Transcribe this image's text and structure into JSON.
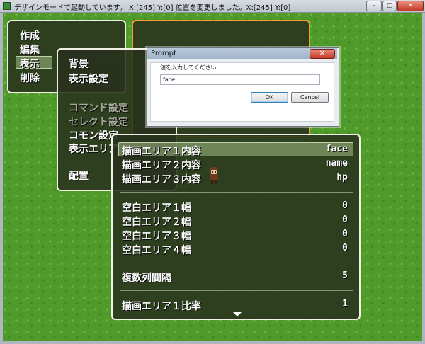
{
  "window": {
    "title": "デザインモードで起動しています。 X:[245] Y:[0] 位置を変更しました。X:[245] Y:[0]",
    "minimize_label": "–",
    "maximize_label": "□",
    "close_label": "✕"
  },
  "main_menu": {
    "items": [
      "作成",
      "編集",
      "表示",
      "削除"
    ],
    "selected_index": 2
  },
  "view_menu": {
    "items": [
      {
        "label": "背景",
        "enabled": true
      },
      {
        "label": "表示設定",
        "enabled": true
      },
      {
        "label": "コマンド設定",
        "enabled": false
      },
      {
        "label": "セレクト設定",
        "enabled": false
      },
      {
        "label": "コモン設定",
        "enabled": true
      },
      {
        "label": "表示エリア",
        "enabled": true
      },
      {
        "label": "配置",
        "enabled": true
      }
    ]
  },
  "settings_list": {
    "rows": [
      {
        "label": "描画エリア１内容",
        "value": "face"
      },
      {
        "label": "描画エリア２内容",
        "value": "name"
      },
      {
        "label": "描画エリア３内容",
        "value": "hp"
      },
      {
        "label": "空白エリア１幅",
        "value": "0"
      },
      {
        "label": "空白エリア２幅",
        "value": "0"
      },
      {
        "label": "空白エリア３幅",
        "value": "0"
      },
      {
        "label": "空白エリア４幅",
        "value": "0"
      },
      {
        "label": "複数列間隔",
        "value": "5"
      },
      {
        "label": "描画エリア１比率",
        "value": "1"
      }
    ],
    "selected_index": 0
  },
  "prompt": {
    "title": "Prompt",
    "close_label": "✕",
    "message": "値を入力してください",
    "input_value": "face",
    "ok_label": "OK",
    "cancel_label": "Cancel"
  },
  "colors": {
    "grass": "#4f9a2b",
    "window_bg": "#28301c",
    "window_border": "#f1f1e6",
    "highlight_border": "#f4a032"
  }
}
